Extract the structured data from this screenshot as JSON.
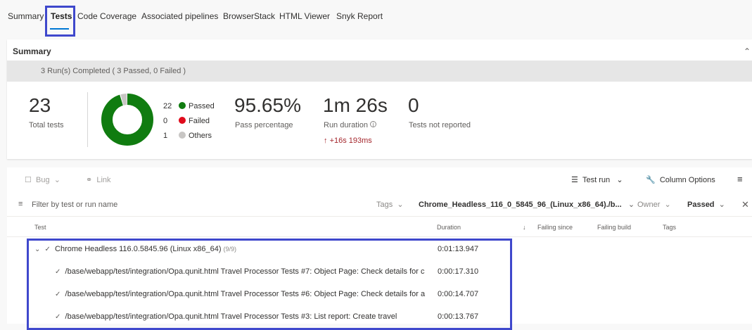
{
  "tabs": [
    {
      "label": "Summary"
    },
    {
      "label": "Tests"
    },
    {
      "label": "Code Coverage"
    },
    {
      "label": "Associated pipelines"
    },
    {
      "label": "BrowserStack"
    },
    {
      "label": "HTML Viewer"
    },
    {
      "label": "Snyk Report"
    }
  ],
  "summary": {
    "title": "Summary",
    "runs_text": "3 Run(s) Completed ( 3 Passed, 0 Failed )",
    "total_tests": "23",
    "total_tests_label": "Total tests",
    "legend": [
      {
        "count": "22",
        "label": "Passed",
        "color": "#107c10",
        "value": 22
      },
      {
        "count": "0",
        "label": "Failed",
        "color": "#e00b1c",
        "value": 0
      },
      {
        "count": "1",
        "label": "Others",
        "color": "#c8c6c4",
        "value": 1
      }
    ],
    "pass_pct": "95.65%",
    "pass_pct_label": "Pass percentage",
    "duration": "1m 26s",
    "duration_label": "Run duration",
    "duration_delta": "+16s 193ms",
    "not_reported": "0",
    "not_reported_label": "Tests not reported"
  },
  "toolbar": {
    "bug": "Bug",
    "link": "Link",
    "test_run": "Test run",
    "column_options": "Column Options"
  },
  "filters": {
    "placeholder": "Filter by test or run name",
    "tags": "Tags",
    "run": "Chrome_Headless_116_0_5845_96_(Linux_x86_64)./b...",
    "owner": "Owner",
    "outcome": "Passed"
  },
  "columns": {
    "test": "Test",
    "duration": "Duration",
    "failing_since": "Failing since",
    "failing_build": "Failing build",
    "tags": "Tags"
  },
  "group": {
    "name": "Chrome Headless 116.0.5845.96 (Linux x86_64)",
    "count": "(9/9)",
    "duration": "0:01:13.947"
  },
  "rows": [
    {
      "name": "/base/webapp/test/integration/Opa.qunit.html Travel Processor Tests #7: Object Page: Check details for c",
      "duration": "0:00:17.310"
    },
    {
      "name": "/base/webapp/test/integration/Opa.qunit.html Travel Processor Tests #6: Object Page: Check details for a",
      "duration": "0:00:14.707"
    },
    {
      "name": "/base/webapp/test/integration/Opa.qunit.html Travel Processor Tests #3: List report: Create travel",
      "duration": "0:00:13.767"
    }
  ]
}
